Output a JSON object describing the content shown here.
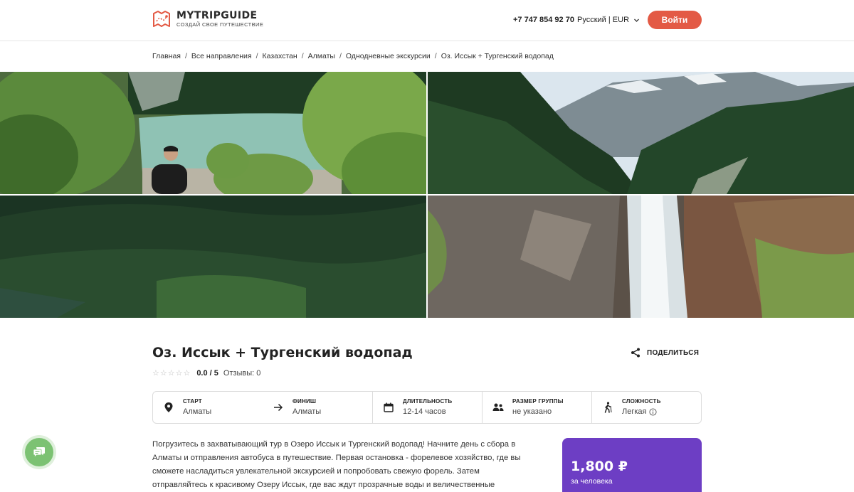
{
  "header": {
    "logo_name": "MYTRIPGUIDE",
    "logo_tagline": "СОЗДАЙ СВОЕ ПУТЕШЕСТВИЕ",
    "phone": "+7 747 854 92 70",
    "language_currency": "Русский | EUR",
    "login_label": "Войти",
    "accent_color": "#e35a45"
  },
  "breadcrumbs": [
    "Главная",
    "Все направления",
    "Казахстан",
    "Алматы",
    "Однодневные экскурсии",
    "Оз. Иссык + Тургенский водопад"
  ],
  "gallery": [
    "lake-photo",
    "mountain-valley-photo",
    "forest-slope-photo",
    "waterfall-photo"
  ],
  "tour": {
    "title": "Оз. Иссык + Тургенский водопад",
    "share_label": "ПОДЕЛИТЬСЯ",
    "stars": "☆☆☆☆☆",
    "score": "0.0 / 5",
    "reviews": "Отзывы: 0"
  },
  "info": {
    "start_label": "СТАРТ",
    "start_value": "Алматы",
    "finish_label": "ФИНИШ",
    "finish_value": "Алматы",
    "duration_label": "ДЛИТЕЛЬНОСТЬ",
    "duration_value": "12-14 часов",
    "group_label": "РАЗМЕР ГРУППЫ",
    "group_value": "не указано",
    "difficulty_label": "СЛОЖНОСТЬ",
    "difficulty_value": "Легкая"
  },
  "description": {
    "line1": "Погрузитесь в захватывающий тур в Озеро Иссык и Тургенский водопад! Начните день с сбора в",
    "line2": "Алматы и отправления автобуса в путешествие. Первая остановка - форелевое хозяйство, где вы",
    "line3": "сможете насладиться увлекательной экскурсией и попробовать свежую форель. Затем",
    "line4": "отправляйтесь к красивому Озеру Иссык, где вас ждут прозрачные воды и величественные"
  },
  "price": {
    "amount": "1,800 ₽",
    "per": "за человека",
    "card_color": "#6d3ec4"
  },
  "chat": {
    "icon": "chat-icon",
    "color": "#7cc273"
  }
}
